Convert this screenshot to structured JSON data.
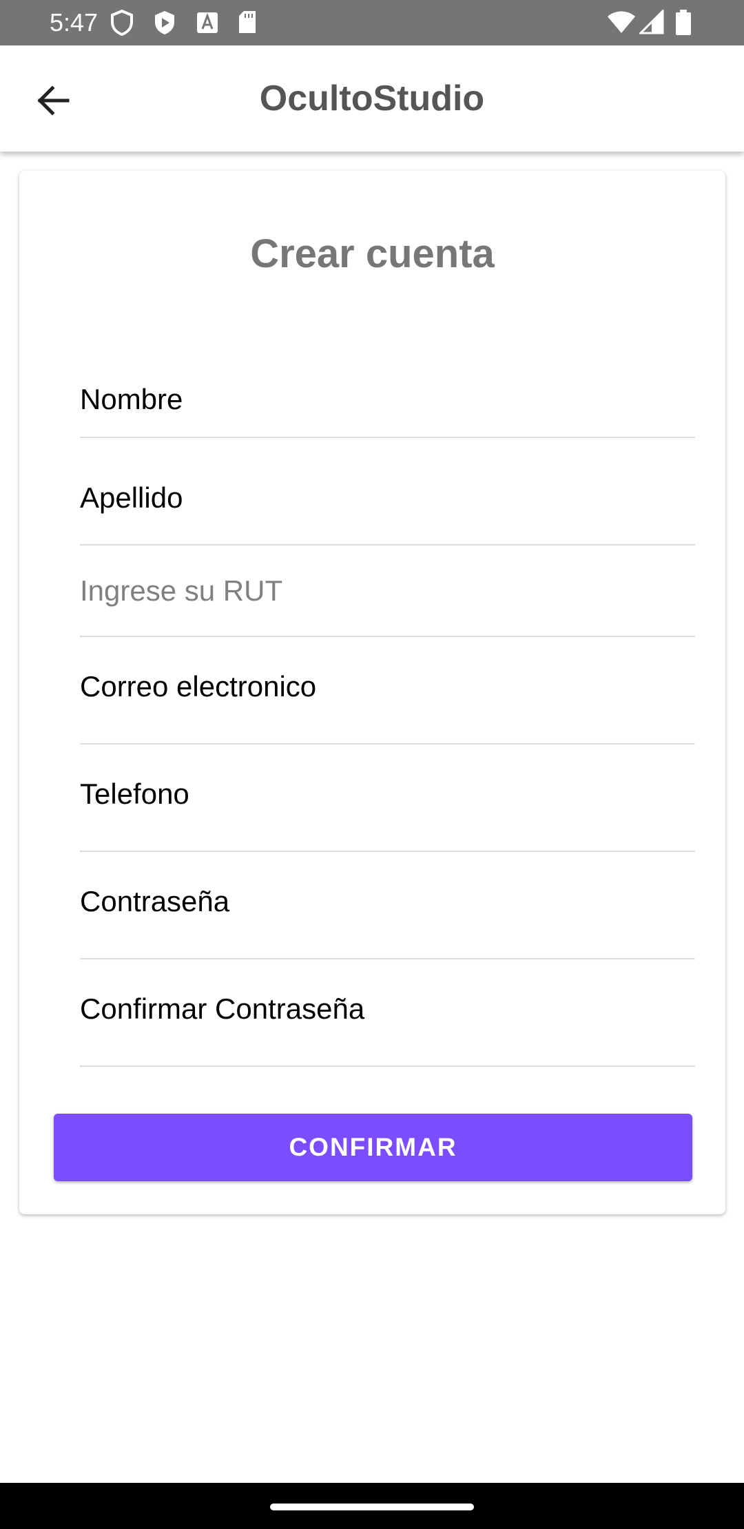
{
  "status_bar": {
    "time": "5:47",
    "left_icons": [
      "shield-icon",
      "play-store-icon",
      "font-icon",
      "sd-card-icon"
    ],
    "right_icons": [
      "wifi-icon",
      "signal-icon",
      "battery-icon"
    ]
  },
  "app_bar": {
    "title": "OcultoStudio",
    "back_icon": "arrow-left-icon"
  },
  "form": {
    "title": "Crear cuenta",
    "fields": [
      {
        "label": "Nombre",
        "kind": "value"
      },
      {
        "label": "Apellido",
        "kind": "value"
      },
      {
        "label": "Ingrese su RUT",
        "kind": "placeholder"
      },
      {
        "label": "Correo electronico",
        "kind": "value"
      },
      {
        "label": "Telefono",
        "kind": "value"
      },
      {
        "label": "Contraseña",
        "kind": "value"
      },
      {
        "label": "Confirmar Contraseña",
        "kind": "value"
      }
    ],
    "confirm_label": "CONFIRMAR"
  },
  "colors": {
    "status_bar": "#757575",
    "accent": "#7c4dff",
    "title_gray": "#777777"
  }
}
